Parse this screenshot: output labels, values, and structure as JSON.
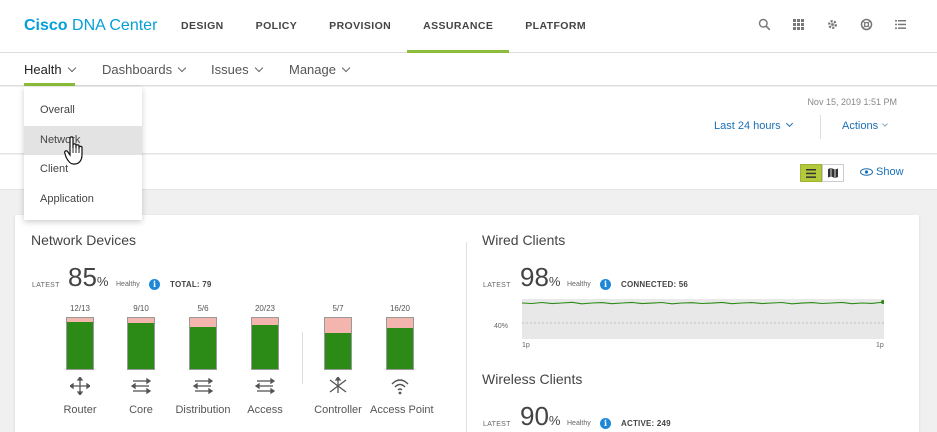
{
  "app": {
    "brand_bold": "Cisco",
    "brand_rest": " DNA Center"
  },
  "top_nav": [
    {
      "label": "DESIGN"
    },
    {
      "label": "POLICY"
    },
    {
      "label": "PROVISION"
    },
    {
      "label": "ASSURANCE",
      "active": true
    },
    {
      "label": "PLATFORM"
    }
  ],
  "top_icons": [
    "search-icon",
    "apps-grid-icon",
    "gear-icon",
    "help-icon",
    "menu-list-icon"
  ],
  "sub_nav": [
    {
      "label": "Health",
      "active": true
    },
    {
      "label": "Dashboards"
    },
    {
      "label": "Issues"
    },
    {
      "label": "Manage"
    }
  ],
  "health_menu": [
    {
      "label": "Overall"
    },
    {
      "label": "Network",
      "hover": true
    },
    {
      "label": "Client"
    },
    {
      "label": "Application"
    }
  ],
  "header": {
    "timestamp": "Nov 15, 2019 1:51 PM",
    "time_range": "Last 24 hours",
    "actions": "Actions"
  },
  "toolbar": {
    "show_label": "Show",
    "view_icons": [
      "list-view-icon",
      "map-view-icon"
    ]
  },
  "network_devices": {
    "title": "Network Devices",
    "latest_label": "LATEST",
    "score": "85",
    "percent_sign": "%",
    "healthy_label": "Healthy",
    "total": "TOTAL: 79",
    "devices": [
      {
        "ratio": "12/13",
        "label": "Router",
        "healthy": 12,
        "total": 13,
        "icon": "router-icon"
      },
      {
        "ratio": "9/10",
        "label": "Core",
        "healthy": 9,
        "total": 10,
        "icon": "core-switch-icon"
      },
      {
        "ratio": "5/6",
        "label": "Distribution",
        "healthy": 5,
        "total": 6,
        "icon": "distribution-switch-icon"
      },
      {
        "ratio": "20/23",
        "label": "Access",
        "healthy": 20,
        "total": 23,
        "icon": "access-switch-icon"
      },
      {
        "ratio": "5/7",
        "label": "Controller",
        "healthy": 5,
        "total": 7,
        "icon": "controller-icon"
      },
      {
        "ratio": "16/20",
        "label": "Access Point",
        "healthy": 16,
        "total": 20,
        "icon": "access-point-icon"
      }
    ]
  },
  "wired_clients": {
    "title": "Wired Clients",
    "latest_label": "LATEST",
    "score": "98",
    "percent_sign": "%",
    "healthy_label": "Healthy",
    "connected": "CONNECTED: 56",
    "trend_y_label": "40%",
    "trend_x_start": "1p",
    "trend_x_end": "1p"
  },
  "wireless_clients": {
    "title": "Wireless Clients",
    "latest_label": "LATEST",
    "score": "90",
    "percent_sign": "%",
    "healthy_label": "Healthy",
    "active": "ACTIVE: 249"
  },
  "colors": {
    "brand": "#049fd9",
    "accent": "#8bbd3a",
    "healthy_bar": "#2b8b16",
    "unhealthy_bar": "#f4b5ae",
    "link": "#1a6fb5"
  }
}
